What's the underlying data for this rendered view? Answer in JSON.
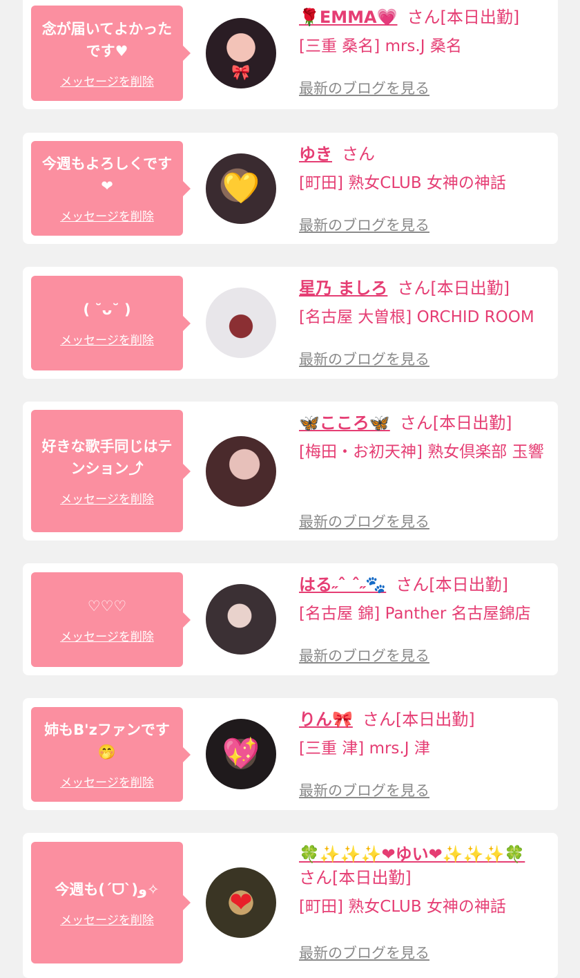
{
  "delete_label": "メッセージを削除",
  "blog_label": "最新のブログを見る",
  "honorific": "さん",
  "items": [
    {
      "message": "念が届いてよかったです♥",
      "name": "🌹EMMA💗",
      "status": "さん[本日出勤]",
      "shop": "[三重 桑名] mrs.J 桑名",
      "avatar_icon": "🎀"
    },
    {
      "message": "今週もよろしくです❤",
      "name": "ゆき",
      "status": "さん",
      "shop": "[町田] 熟女CLUB 女神の神話",
      "avatar_icon": "💛"
    },
    {
      "message": "( ˘ᴗ˘ )",
      "name": "星乃 ましろ",
      "status": "さん[本日出勤]",
      "shop": "[名古屋 大曽根] ORCHID ROOM",
      "avatar_icon": ""
    },
    {
      "message": "好きな歌手同じはテンション⤴",
      "name": "🦋こころ🦋",
      "status": "さん[本日出勤]",
      "shop": "[梅田・お初天神] 熟女倶楽部 玉響",
      "avatar_icon": ""
    },
    {
      "message": "♡♡♡",
      "name": "はる˶ˆ ˆ˶🐾",
      "status": "さん[本日出勤]",
      "shop": "[名古屋 錦] Panther 名古屋錦店",
      "avatar_icon": ""
    },
    {
      "message": "姉もB'zファンです🤭",
      "name": "りん🎀",
      "status": "さん[本日出勤]",
      "shop": "[三重 津] mrs.J 津",
      "avatar_icon": "💖"
    },
    {
      "message": "今週も(ˊᗜˋ)و✧",
      "name": "🍀✨✨✨❤ゆい❤✨✨✨🍀",
      "status": "さん[本日出勤]",
      "shop": "[町田] 熟女CLUB 女神の神話",
      "avatar_icon": "❤"
    }
  ],
  "colors": {
    "background": "#f1f1f1",
    "bubble": "#fb8fa0",
    "accent": "#e53d73",
    "link_gray": "#8a8a8a"
  }
}
